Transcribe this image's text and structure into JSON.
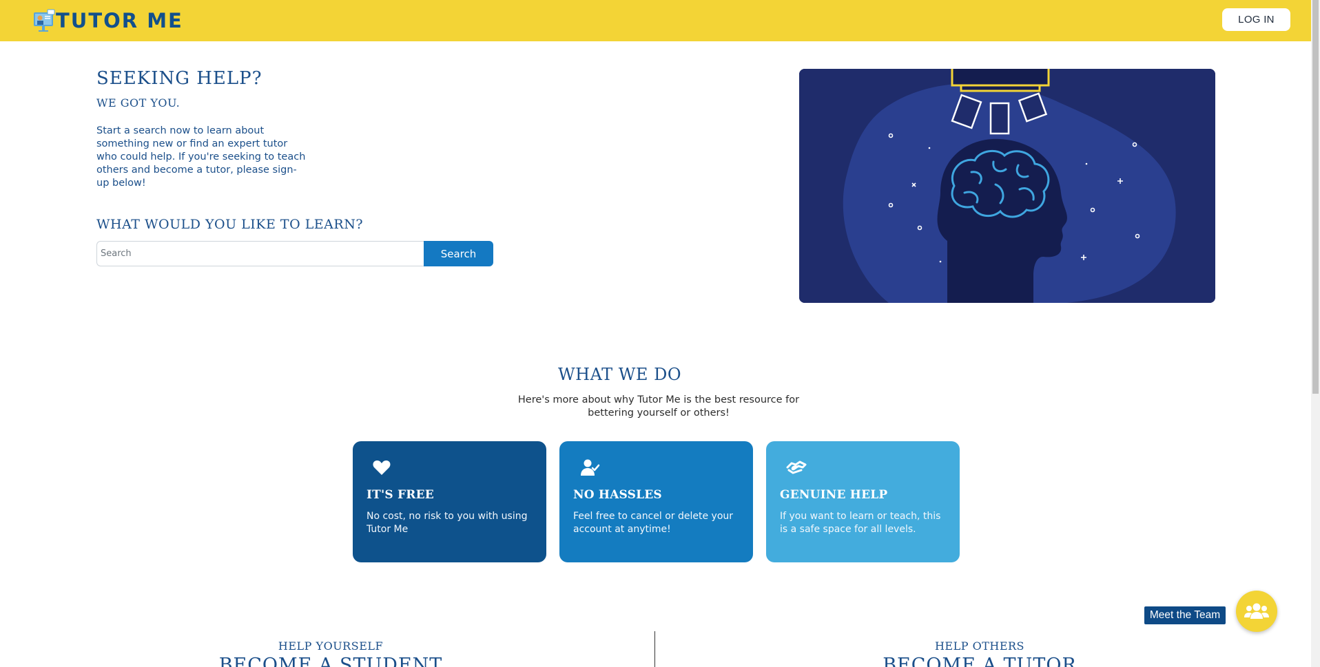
{
  "header": {
    "brand": "TUTOR ME",
    "login_label": "LOG IN"
  },
  "hero": {
    "title": "SEEKING HELP?",
    "subtitle": "WE GOT YOU.",
    "description": "Start a search now to learn about something new or find an expert tutor who could help. If you're seeking to teach others and become a tutor, please sign-up below!",
    "search_heading": "WHAT WOULD YOU LIKE TO LEARN?",
    "search": {
      "placeholder": "Search",
      "value": "",
      "button_label": "Search"
    }
  },
  "what_we_do": {
    "title": "WHAT WE DO",
    "description": "Here's more about why Tutor Me is the best resource for bettering yourself or others!",
    "cards": [
      {
        "icon": "heart-icon",
        "title": "IT'S FREE",
        "text": "No cost, no risk to you with using Tutor Me",
        "color": "#0e528c"
      },
      {
        "icon": "user-check-icon",
        "title": "NO HASSLES",
        "text": "Feel free to cancel or delete your account at anytime!",
        "color": "#147cc0"
      },
      {
        "icon": "handshake-icon",
        "title": "GENUINE HELP",
        "text": "If you want to learn or teach, this is a safe space for all levels.",
        "color": "#43acdd"
      }
    ]
  },
  "signup": {
    "left_eyebrow": "HELP YOURSELF",
    "left_title": "BECOME A STUDENT",
    "right_eyebrow": "HELP OTHERS",
    "right_title": "BECOME A TUTOR"
  },
  "floating": {
    "team_label": "Meet the Team",
    "icon": "users-icon"
  },
  "colors": {
    "header_bg": "#f3d436",
    "primary": "#1b4f8a",
    "button": "#1479c2",
    "illustration_bg": "#1f2c6b"
  }
}
